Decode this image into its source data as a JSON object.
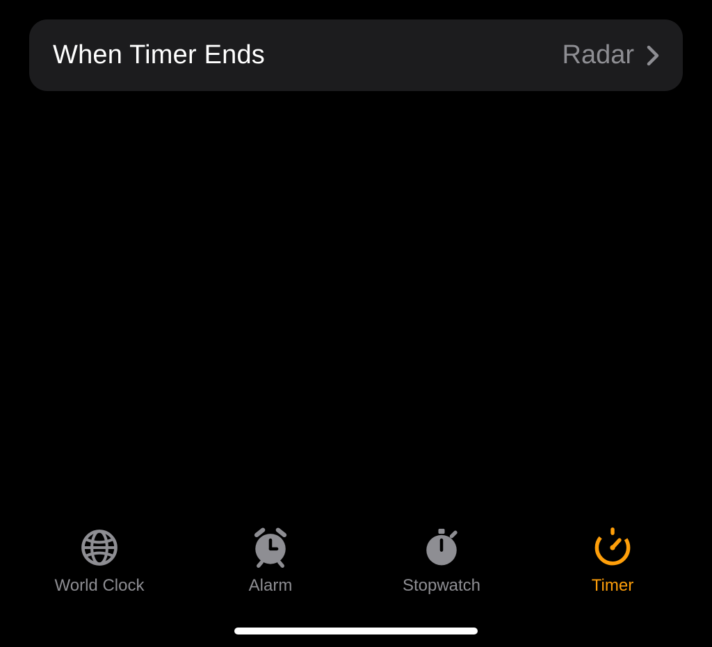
{
  "settings": {
    "whenTimerEnds": {
      "label": "When Timer Ends",
      "value": "Radar"
    }
  },
  "tabs": [
    {
      "id": "world-clock",
      "label": "World Clock",
      "active": false
    },
    {
      "id": "alarm",
      "label": "Alarm",
      "active": false
    },
    {
      "id": "stopwatch",
      "label": "Stopwatch",
      "active": false
    },
    {
      "id": "timer",
      "label": "Timer",
      "active": true
    }
  ],
  "colors": {
    "accent": "#ff9f0a",
    "inactive": "#8e8e93",
    "rowBg": "#1c1c1e"
  }
}
